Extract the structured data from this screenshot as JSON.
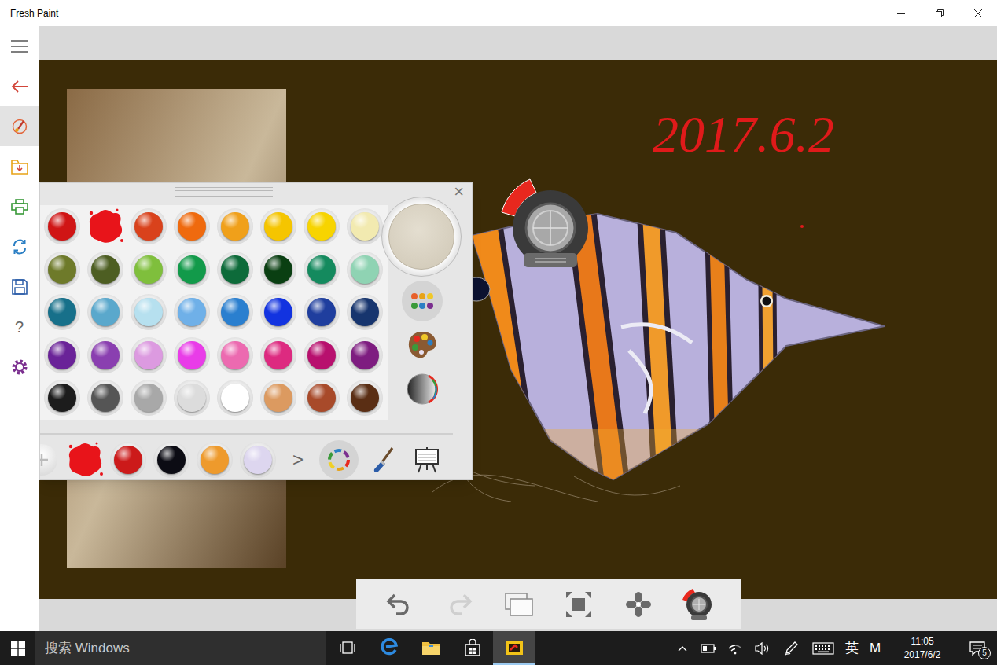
{
  "window": {
    "title": "Fresh Paint"
  },
  "sidebar": {
    "items": [
      {
        "kind": "menu",
        "selected": false
      },
      {
        "kind": "back",
        "selected": false
      },
      {
        "kind": "paint",
        "selected": true
      },
      {
        "kind": "import",
        "selected": false
      },
      {
        "kind": "print",
        "selected": false
      },
      {
        "kind": "share",
        "selected": false
      },
      {
        "kind": "save",
        "selected": false
      },
      {
        "kind": "help",
        "label": "?",
        "selected": false
      },
      {
        "kind": "settings",
        "selected": false
      }
    ]
  },
  "canvas": {
    "note": "2017.6.2"
  },
  "palette": {
    "close": "×",
    "colors": [
      {
        "color": "#d01515",
        "selected": false
      },
      {
        "color": "#e8141a",
        "selected": true
      },
      {
        "color": "#d9421c",
        "selected": false
      },
      {
        "color": "#ef6a0e",
        "selected": false
      },
      {
        "color": "#f0a01a",
        "selected": false
      },
      {
        "color": "#f5c500",
        "selected": false
      },
      {
        "color": "#f7d400",
        "selected": false
      },
      {
        "color": "#f2eab0",
        "selected": false
      },
      {
        "color": "#6e7a2a",
        "selected": false
      },
      {
        "color": "#4d5e22",
        "selected": false
      },
      {
        "color": "#7fbf3c",
        "selected": false
      },
      {
        "color": "#129a4a",
        "selected": false
      },
      {
        "color": "#0d6b3a",
        "selected": false
      },
      {
        "color": "#0a3f12",
        "selected": false
      },
      {
        "color": "#148a5e",
        "selected": false
      },
      {
        "color": "#8fd3b3",
        "selected": false
      },
      {
        "color": "#17708a",
        "selected": false
      },
      {
        "color": "#5aa8cc",
        "selected": false
      },
      {
        "color": "#b6e0ef",
        "selected": false
      },
      {
        "color": "#6fb0e8",
        "selected": false
      },
      {
        "color": "#2a7fcf",
        "selected": false
      },
      {
        "color": "#1233e0",
        "selected": false
      },
      {
        "color": "#1f3e9e",
        "selected": false
      },
      {
        "color": "#17356e",
        "selected": false
      },
      {
        "color": "#6a2398",
        "selected": false
      },
      {
        "color": "#8a3fb0",
        "selected": false
      },
      {
        "color": "#dc9ae0",
        "selected": false
      },
      {
        "color": "#e93ce8",
        "selected": false
      },
      {
        "color": "#ec6ab0",
        "selected": false
      },
      {
        "color": "#dd2a80",
        "selected": false
      },
      {
        "color": "#b8106e",
        "selected": false
      },
      {
        "color": "#7e1d80",
        "selected": false
      },
      {
        "color": "#1c1c1c",
        "selected": false
      },
      {
        "color": "#555555",
        "selected": false
      },
      {
        "color": "#a8a8a8",
        "selected": false
      },
      {
        "color": "#dcdcdc",
        "selected": false
      },
      {
        "color": "#ffffff",
        "selected": false
      },
      {
        "color": "#dc9a60",
        "selected": false
      },
      {
        "color": "#a84a2a",
        "selected": false
      },
      {
        "color": "#5a2e14",
        "selected": false
      }
    ],
    "tools": [
      {
        "kind": "swatches",
        "selected": true
      },
      {
        "kind": "mixer",
        "selected": false
      },
      {
        "kind": "gradient",
        "selected": false
      }
    ],
    "recent": [
      {
        "kind": "add",
        "selected": false
      },
      {
        "kind": "splash",
        "color": "#e8141a",
        "selected": true
      },
      {
        "kind": "drop",
        "color": "#cc1a1a",
        "selected": false
      },
      {
        "kind": "drop",
        "color": "#0c0c14",
        "selected": false
      },
      {
        "kind": "drop",
        "color": "#ee9a2c",
        "selected": false
      },
      {
        "kind": "drop",
        "color": "#ddd6ef",
        "selected": false
      }
    ],
    "more": ">",
    "modes": [
      {
        "kind": "colors",
        "selected": true
      },
      {
        "kind": "brush",
        "selected": false
      },
      {
        "kind": "canvas",
        "selected": false
      }
    ]
  },
  "toolbar": {
    "buttons": [
      {
        "kind": "undo",
        "disabled": false
      },
      {
        "kind": "redo",
        "disabled": true
      },
      {
        "kind": "layers",
        "disabled": false
      },
      {
        "kind": "fit",
        "disabled": false
      },
      {
        "kind": "dry",
        "disabled": false
      },
      {
        "kind": "tool",
        "disabled": false
      }
    ]
  },
  "taskbar": {
    "search": {
      "placeholder": "搜索 Windows"
    },
    "apps": [
      {
        "kind": "taskview",
        "active": false
      },
      {
        "kind": "edge",
        "active": false
      },
      {
        "kind": "explorer",
        "active": false
      },
      {
        "kind": "store",
        "active": false
      },
      {
        "kind": "freshpaint",
        "active": true
      }
    ],
    "tray": {
      "ime": "英",
      "ime_mode": "M",
      "time": "11:05",
      "date": "2017/6/2",
      "notifications": "5"
    }
  }
}
